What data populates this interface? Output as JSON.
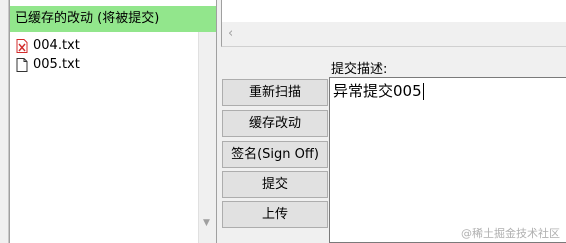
{
  "staged": {
    "header": "已缓存的改动 (将被提交)",
    "files": [
      {
        "name": "004.txt",
        "icon": "file-deleted-icon"
      },
      {
        "name": "005.txt",
        "icon": "file-icon"
      }
    ]
  },
  "commit": {
    "label": "提交描述:",
    "message": "异常提交005"
  },
  "buttons": {
    "rescan": "重新扫描",
    "stage": "缓存改动",
    "signoff": "签名(Sign Off)",
    "commit": "提交",
    "push": "上传"
  },
  "watermark": "@稀土掘金技术社区",
  "colors": {
    "staged_header": "#92e68c",
    "deleted_icon": "#d22b2b"
  }
}
